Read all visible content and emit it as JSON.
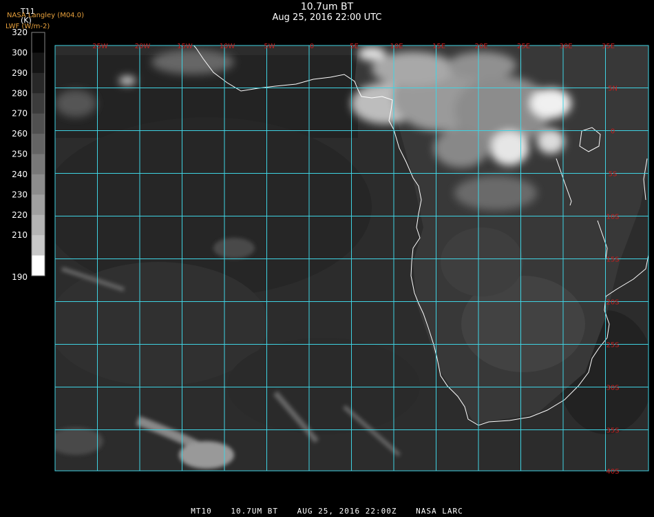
{
  "header": {
    "title": "10.7um BT",
    "subtitle": "Aug 25, 2016 22:00 UTC",
    "legend_var": "T11",
    "legend_unit": "(K)",
    "provider": "NASA Langley (M04.0)",
    "overlay_label": "LWF (W/m-2)"
  },
  "colorbar": {
    "ticks": [
      "320",
      "300",
      "290",
      "280",
      "270",
      "260",
      "250",
      "240",
      "230",
      "220",
      "210",
      "190"
    ],
    "swatches": [
      "#000000",
      "#141414",
      "#282828",
      "#3c3c3c",
      "#505050",
      "#646464",
      "#787878",
      "#8c8c8c",
      "#a0a0a0",
      "#b4b4b4",
      "#c8c8c8",
      "#ffffff"
    ]
  },
  "map": {
    "lon_labels": [
      "25W",
      "20W",
      "15W",
      "10W",
      "5W",
      "0",
      "5E",
      "10E",
      "15E",
      "20E",
      "25E",
      "30E",
      "35E"
    ],
    "lat_labels": [
      "5N",
      "0",
      "5S",
      "10S",
      "15S",
      "20S",
      "25S",
      "30S",
      "35S",
      "40S"
    ],
    "grid_color": "#3fd4e4",
    "label_color": "#c81e1e",
    "coast_color": "#ffffff",
    "background_color": "#2c2c2c"
  },
  "footer": {
    "satellite": "MT10",
    "channel": "10.7UM BT",
    "datetime": "AUG 25, 2016 22:00Z",
    "org": "NASA LARC"
  }
}
